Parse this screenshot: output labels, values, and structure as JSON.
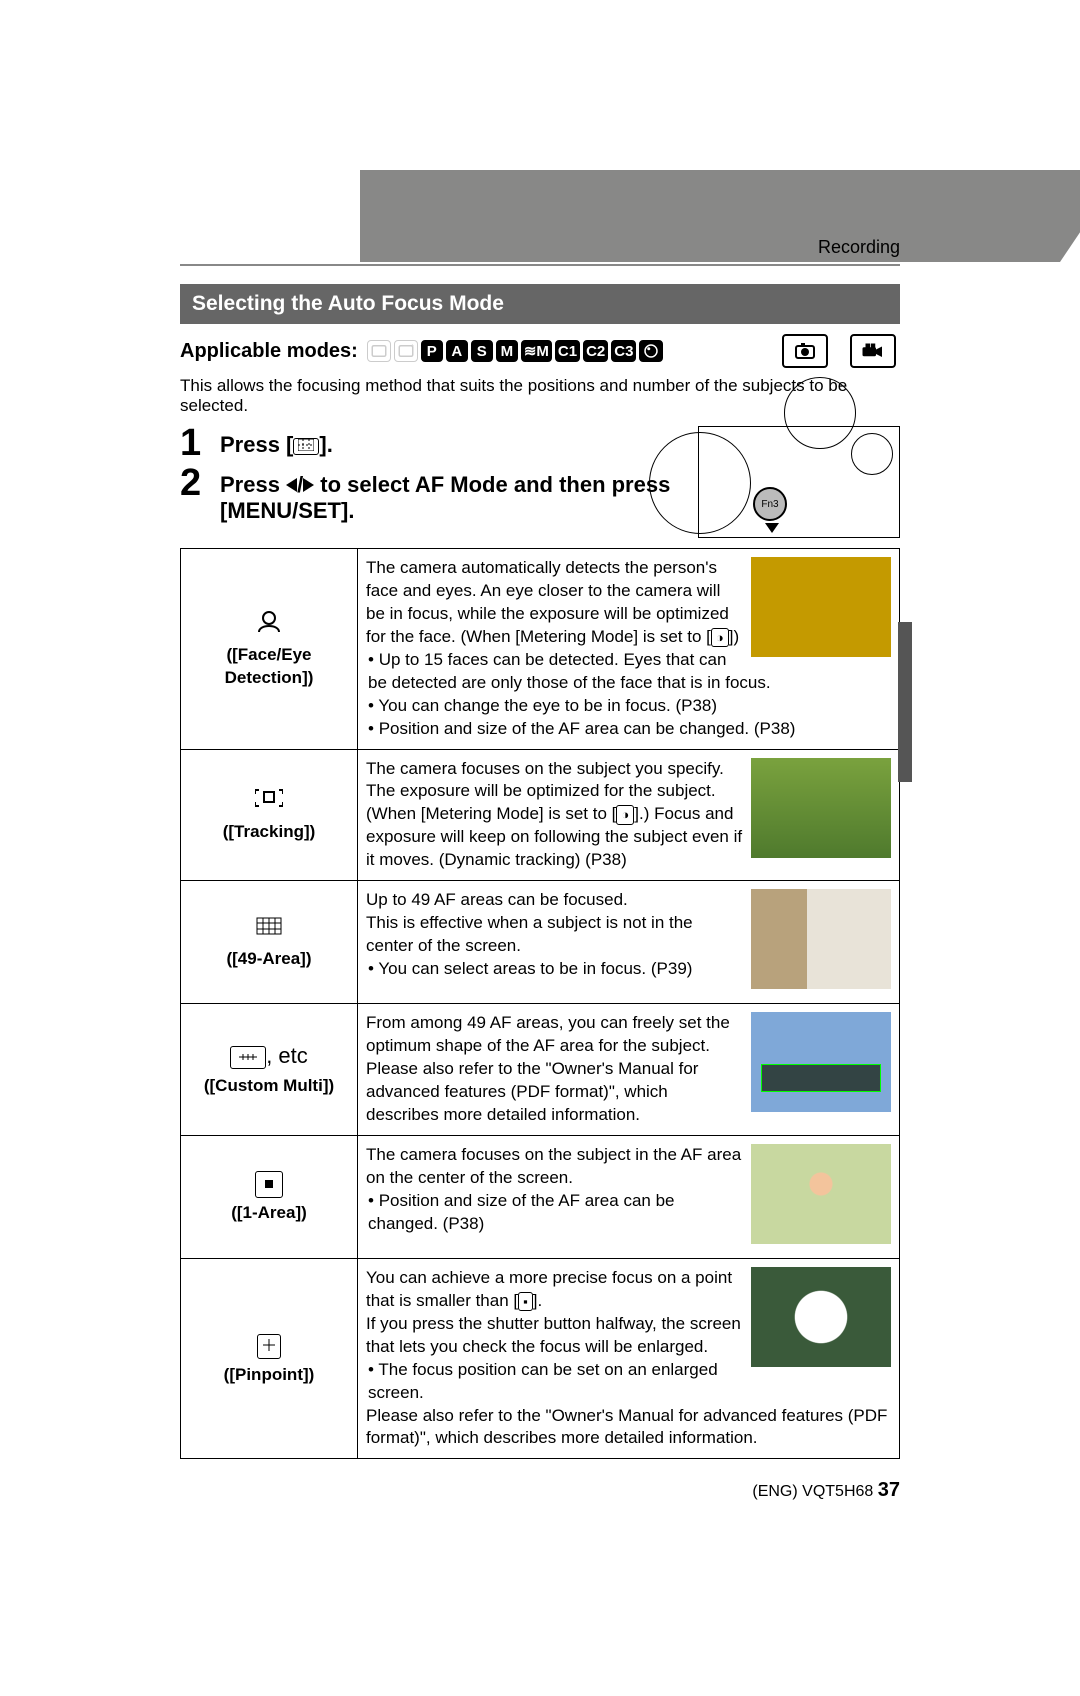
{
  "chapter": "Recording",
  "section_title": "Selecting the Auto Focus Mode",
  "applicable_modes_label": "Applicable modes:",
  "mode_icons": [
    "iA",
    "iA+",
    "P",
    "A",
    "S",
    "M",
    "≋M",
    "C1",
    "C2",
    "C3",
    "SCN"
  ],
  "intro": "This allows the focusing method that suits the positions and number of the subjects to be selected.",
  "steps": [
    {
      "num": "1",
      "text_a": "Press [",
      "text_b": "]."
    },
    {
      "num": "2",
      "text_a": "Press ",
      "text_mid": " to select AF Mode and then press",
      "text_b": "[MENU/SET]."
    }
  ],
  "fn_label": "Fn3",
  "af_modes": [
    {
      "icon": "face-eye-icon",
      "name": "([Face/Eye Detection])",
      "body": "The camera automatically detects the person's face and eyes.\nAn eye closer to the camera will be in focus, while the exposure will be optimized for the face. (When [Metering Mode] is set to [",
      "body_tail": "])",
      "bullets": [
        "Up to 15 faces can be detected. Eyes that can be detected are only those of the face that is in focus.",
        "You can change the eye to be in focus. (P38)",
        "Position and size of the AF area can be changed. (P38)"
      ],
      "sample_class": "fruit"
    },
    {
      "icon": "tracking-icon",
      "name": "([Tracking])",
      "body": "The camera focuses on the subject you specify. The exposure will be optimized for the subject. (When [Metering Mode] is set to [",
      "body_tail": "].)\nFocus and exposure will keep on following the subject even if it moves. (Dynamic tracking) (P38)",
      "bullets": [],
      "sample_class": "green"
    },
    {
      "icon": "area49-icon",
      "name": "([49-Area])",
      "body": "Up to 49 AF areas can be focused.\nThis is effective when a subject is not in the center of the screen.",
      "bullets": [
        "You can select areas to be in focus. (P39)"
      ],
      "sample_class": "room"
    },
    {
      "icon": "custom-multi-icon",
      "name_prefix": ", etc",
      "name": "([Custom Multi])",
      "body": "From among 49 AF areas, you can freely set the optimum shape of the AF area for the subject.\nPlease also refer to the \"Owner's Manual for advanced features (PDF format)\", which describes more detailed information.",
      "bullets": [],
      "sample_class": "train"
    },
    {
      "icon": "area1-icon",
      "name": "([1-Area])",
      "body": "The camera focuses on the subject in the AF area on the center of the screen.",
      "bullets": [
        "Position and size of the AF area can be changed. (P38)"
      ],
      "sample_class": "face"
    },
    {
      "icon": "pinpoint-icon",
      "name": "([Pinpoint])",
      "body": "You can achieve a more precise focus on a point that is smaller than [",
      "body_tail": "].\nIf you press the shutter button halfway, the screen that lets you check the focus will be enlarged.",
      "bullets": [
        "The focus position can be set on an enlarged screen."
      ],
      "tail": "Please also refer to the \"Owner's Manual for advanced features (PDF format)\", which describes more detailed information.",
      "sample_class": "flower"
    }
  ],
  "footer_code": "(ENG) VQT5H68",
  "footer_page": "37"
}
